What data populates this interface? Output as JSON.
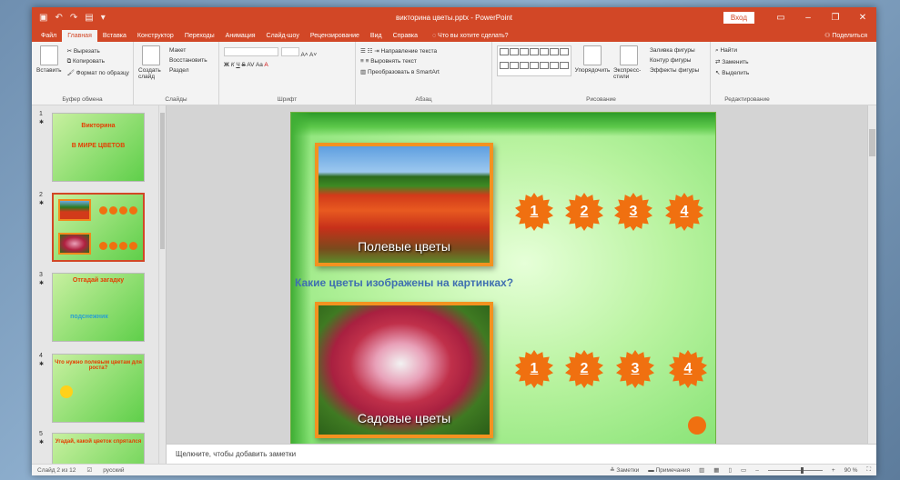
{
  "window": {
    "title": "викторина цветы.pptx  -  PowerPoint",
    "signin": "Вход"
  },
  "tabs": [
    "Файл",
    "Главная",
    "Вставка",
    "Конструктор",
    "Переходы",
    "Анимация",
    "Слайд-шоу",
    "Рецензирование",
    "Вид",
    "Справка"
  ],
  "active_tab": "Главная",
  "tell_me": "Что вы хотите сделать?",
  "share": "Поделиться",
  "ribbon": {
    "clipboard": {
      "paste": "Вставить",
      "cut": "Вырезать",
      "copy": "Копировать",
      "format_painter": "Формат по образцу",
      "name": "Буфер обмена"
    },
    "slides": {
      "new_slide": "Создать слайд",
      "layout": "Макет",
      "reset": "Восстановить",
      "section": "Раздел",
      "name": "Слайды"
    },
    "font": {
      "name": "Шрифт"
    },
    "paragraph": {
      "text_direction": "Направление текста",
      "align_text": "Выровнять текст",
      "smartart": "Преобразовать в SmartArt",
      "name": "Абзац"
    },
    "drawing": {
      "arrange": "Упорядочить",
      "quick_styles": "Экспресс-стили",
      "fill": "Заливка фигуры",
      "outline": "Контур фигуры",
      "effects": "Эффекты фигуры",
      "name": "Рисование"
    },
    "editing": {
      "find": "Найти",
      "replace": "Заменить",
      "select": "Выделить",
      "name": "Редактирование"
    }
  },
  "thumbnails": [
    {
      "num": "1",
      "title": "Викторина",
      "subtitle": "В МИРЕ ЦВЕТОВ"
    },
    {
      "num": "2"
    },
    {
      "num": "3",
      "title": "Отгадай загадку",
      "subtitle": "подснежник"
    },
    {
      "num": "4",
      "title": "Что нужно полевым цветам для роста?"
    },
    {
      "num": "5",
      "title": "Угадай, какой цветок спрятался"
    }
  ],
  "slide": {
    "photo1_caption": "Полевые цветы",
    "photo2_caption": "Садовые цветы",
    "question": "Какие цветы изображены на картинках?",
    "row1": [
      "1",
      "2",
      "3",
      "4"
    ],
    "row2": [
      "1",
      "2",
      "3",
      "4"
    ]
  },
  "notes_placeholder": "Щелкните, чтобы добавить заметки",
  "status": {
    "slide_info": "Слайд 2 из 12",
    "language": "русский",
    "notes": "Заметки",
    "comments": "Примечания",
    "zoom": "90 %"
  }
}
